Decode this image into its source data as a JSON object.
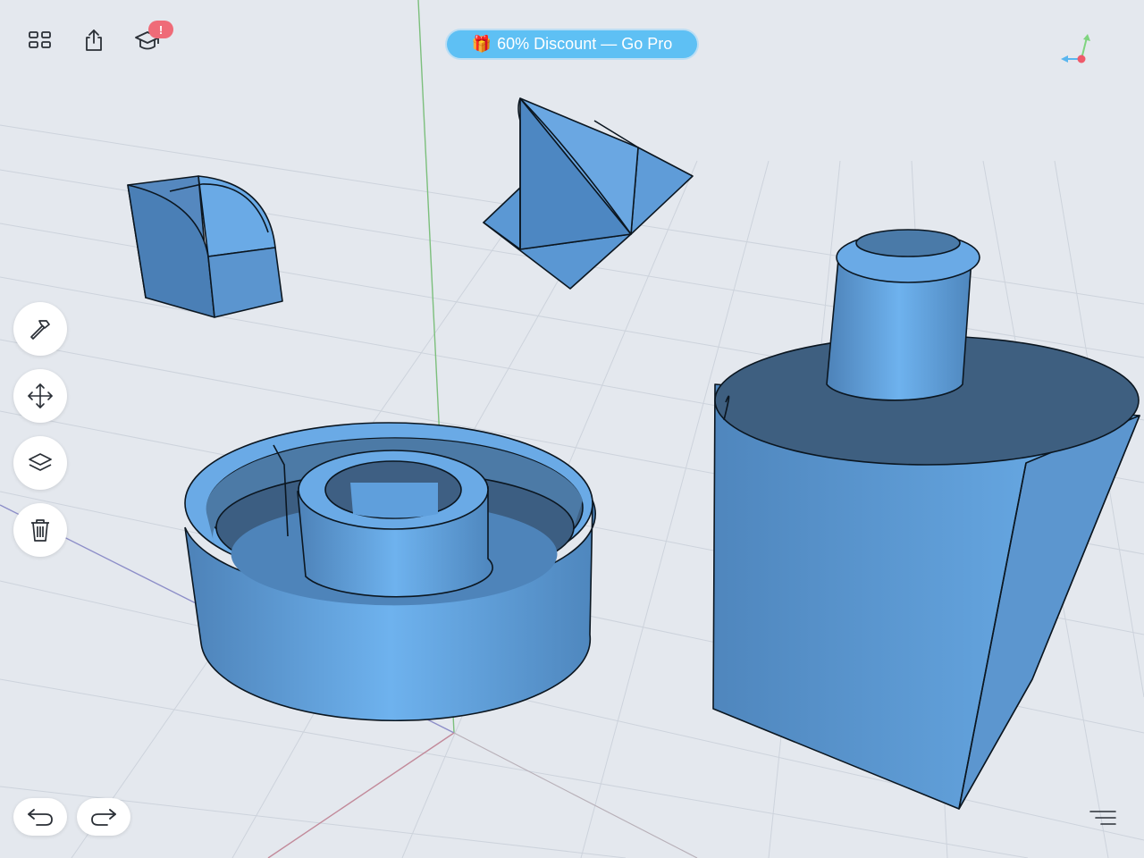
{
  "toolbar": {
    "icons": [
      "grid-icon",
      "share-icon",
      "graduation-cap-icon"
    ],
    "notification_badge": "!"
  },
  "promo_banner": {
    "icon": "gift-icon",
    "label": "60% Discount — Go Pro"
  },
  "side_tools": [
    "hammer-icon",
    "move-icon",
    "layers-icon",
    "trash-icon"
  ],
  "history": [
    "undo-icon",
    "redo-icon"
  ],
  "menu_icon": "menu-lines-icon",
  "colors": {
    "background": "#e4e8ee",
    "grid_line": "#cdd3dc",
    "model_fill": "#5d9bd6",
    "model_dark": "#3e5f80",
    "model_edge": "#0b1620",
    "promo": "#5ec0f4",
    "badge": "#ef6b78",
    "axis_green": "#7cbf7c",
    "axis_red": "#c28a9a",
    "axis_blue": "#8d8ec8"
  }
}
